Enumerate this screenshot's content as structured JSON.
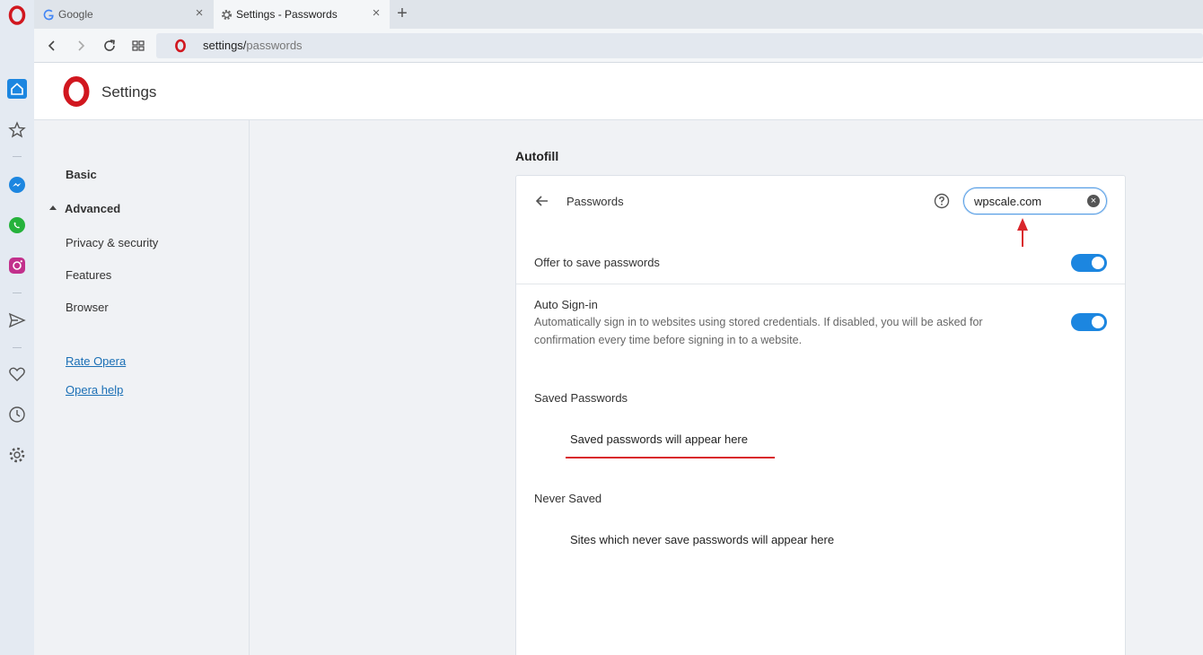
{
  "tabs": [
    {
      "title": "Google",
      "icon": "google-icon"
    },
    {
      "title": "Settings - Passwords",
      "icon": "gear-icon"
    }
  ],
  "address": {
    "url_main": "settings/",
    "url_path": "passwords"
  },
  "header": {
    "title": "Settings"
  },
  "nav": {
    "basic": "Basic",
    "advanced": "Advanced",
    "items": [
      "Privacy & security",
      "Features",
      "Browser"
    ],
    "links": [
      "Rate Opera",
      "Opera help"
    ]
  },
  "main": {
    "heading": "Autofill",
    "card": {
      "title": "Passwords",
      "search_value": "wpscale.com",
      "offer_label": "Offer to save passwords",
      "offer_enabled": true,
      "autosignin_label": "Auto Sign-in",
      "autosignin_desc": "Automatically sign in to websites using stored credentials. If disabled, you will be asked for confirmation every time before signing in to a website.",
      "autosignin_enabled": true,
      "saved_heading": "Saved Passwords",
      "saved_empty": "Saved passwords will appear here",
      "never_heading": "Never Saved",
      "never_empty": "Sites which never save passwords will appear here"
    }
  },
  "colors": {
    "accent": "#1c86e0",
    "annotation": "#d9262c",
    "opera_red": "#d1171f"
  }
}
